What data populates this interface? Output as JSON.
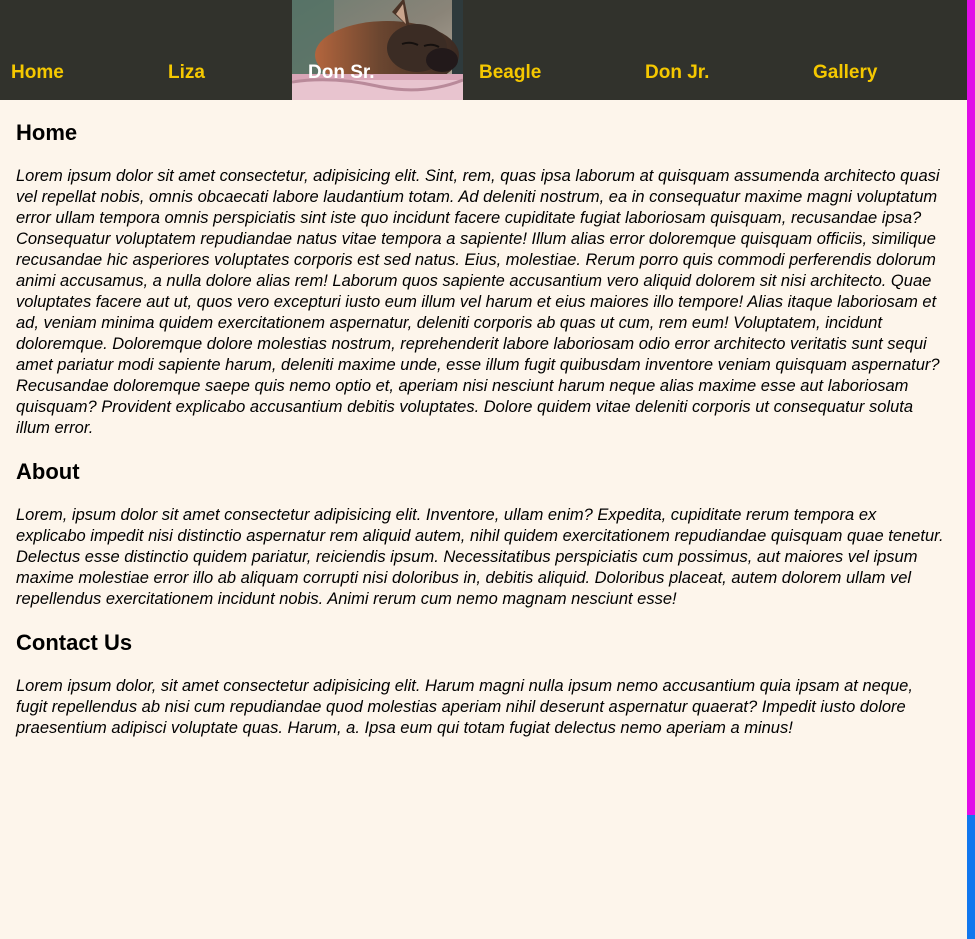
{
  "nav": {
    "items": [
      {
        "label": "Home"
      },
      {
        "label": "Liza"
      },
      {
        "label": "Don Sr."
      },
      {
        "label": "Beagle"
      },
      {
        "label": "Don Jr."
      },
      {
        "label": "Gallery"
      }
    ],
    "active_index": 2,
    "colors": {
      "background": "#31322c",
      "label": "#f5c800",
      "active_label": "#ffffff"
    }
  },
  "sections": [
    {
      "title": "Home",
      "text": "Lorem ipsum dolor sit amet consectetur, adipisicing elit. Sint, rem, quas ipsa laborum at quisquam assumenda architecto quasi vel repellat nobis, omnis obcaecati labore laudantium totam. Ad deleniti nostrum, ea in consequatur maxime magni voluptatum error ullam tempora omnis perspiciatis sint iste quo incidunt facere cupiditate fugiat laboriosam quisquam, recusandae ipsa? Consequatur voluptatem repudiandae natus vitae tempora a sapiente! Illum alias error doloremque quisquam officiis, similique recusandae hic asperiores voluptates corporis est sed natus. Eius, molestiae. Rerum porro quis commodi perferendis dolorum animi accusamus, a nulla dolore alias rem! Laborum quos sapiente accusantium vero aliquid dolorem sit nisi architecto. Quae voluptates facere aut ut, quos vero excepturi iusto eum illum vel harum et eius maiores illo tempore! Alias itaque laboriosam et ad, veniam minima quidem exercitationem aspernatur, deleniti corporis ab quas ut cum, rem eum! Voluptatem, incidunt doloremque. Doloremque dolore molestias nostrum, reprehenderit labore laboriosam odio error architecto veritatis sunt sequi amet pariatur modi sapiente harum, deleniti maxime unde, esse illum fugit quibusdam inventore veniam quisquam aspernatur? Recusandae doloremque saepe quis nemo optio et, aperiam nisi nesciunt harum neque alias maxime esse aut laboriosam quisquam? Provident explicabo accusantium debitis voluptates. Dolore quidem vitae deleniti corporis ut consequatur soluta illum error."
    },
    {
      "title": "About",
      "text": "Lorem, ipsum dolor sit amet consectetur adipisicing elit. Inventore, ullam enim? Expedita, cupiditate rerum tempora ex explicabo impedit nisi distinctio aspernatur rem aliquid autem, nihil quidem exercitationem repudiandae quisquam quae tenetur. Delectus esse distinctio quidem pariatur, reiciendis ipsum. Necessitatibus perspiciatis cum possimus, aut maiores vel ipsum maxime molestiae error illo ab aliquam corrupti nisi doloribus in, debitis aliquid. Doloribus placeat, autem dolorem ullam vel repellendus exercitationem incidunt nobis. Animi rerum cum nemo magnam nesciunt esse!"
    },
    {
      "title": "Contact Us",
      "text": "Lorem ipsum dolor, sit amet consectetur adipisicing elit. Harum magni nulla ipsum nemo accusantium quia ipsam at neque, fugit repellendus ab nisi cum repudiandae quod molestias aperiam nihil deserunt aspernatur quaerat? Impedit iusto dolore praesentium adipisci voluptate quas. Harum, a. Ipsa eum qui totam fugiat delectus nemo aperiam a minus!"
    }
  ],
  "page": {
    "background": "#fdf5eb"
  },
  "scrollbar": {
    "track_color": "#e10de8",
    "thumb_color": "#1177ee"
  }
}
